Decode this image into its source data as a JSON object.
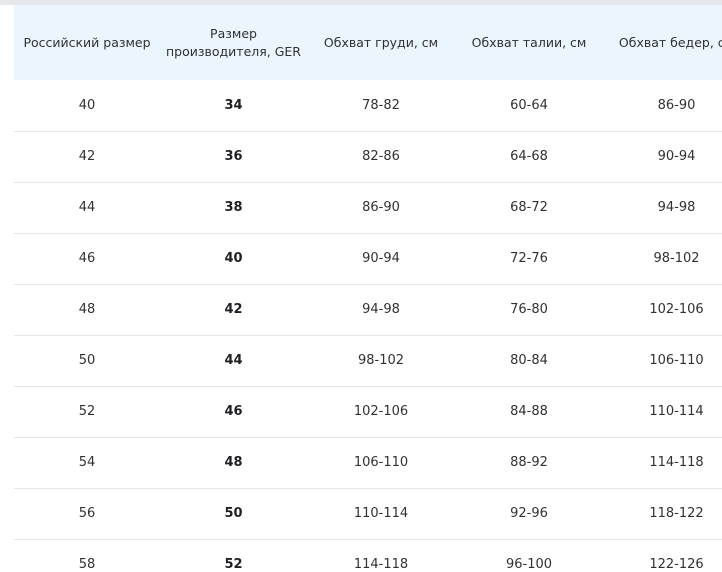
{
  "table": {
    "headers": [
      "Российский размер",
      "Размер производителя, GER",
      "Обхват груди, см",
      "Обхват талии, см",
      "Обхват бедер, см"
    ],
    "rows": [
      [
        "40",
        "34",
        "78-82",
        "60-64",
        "86-90"
      ],
      [
        "42",
        "36",
        "82-86",
        "64-68",
        "90-94"
      ],
      [
        "44",
        "38",
        "86-90",
        "68-72",
        "94-98"
      ],
      [
        "46",
        "40",
        "90-94",
        "72-76",
        "98-102"
      ],
      [
        "48",
        "42",
        "94-98",
        "76-80",
        "102-106"
      ],
      [
        "50",
        "44",
        "98-102",
        "80-84",
        "106-110"
      ],
      [
        "52",
        "46",
        "102-106",
        "84-88",
        "110-114"
      ],
      [
        "54",
        "48",
        "106-110",
        "88-92",
        "114-118"
      ],
      [
        "56",
        "50",
        "110-114",
        "92-96",
        "118-122"
      ],
      [
        "58",
        "52",
        "114-118",
        "96-100",
        "122-126"
      ]
    ]
  },
  "colors": {
    "header_background": "#eaf5fd",
    "text": "#303133",
    "row_divider": "#e3e5e8"
  }
}
